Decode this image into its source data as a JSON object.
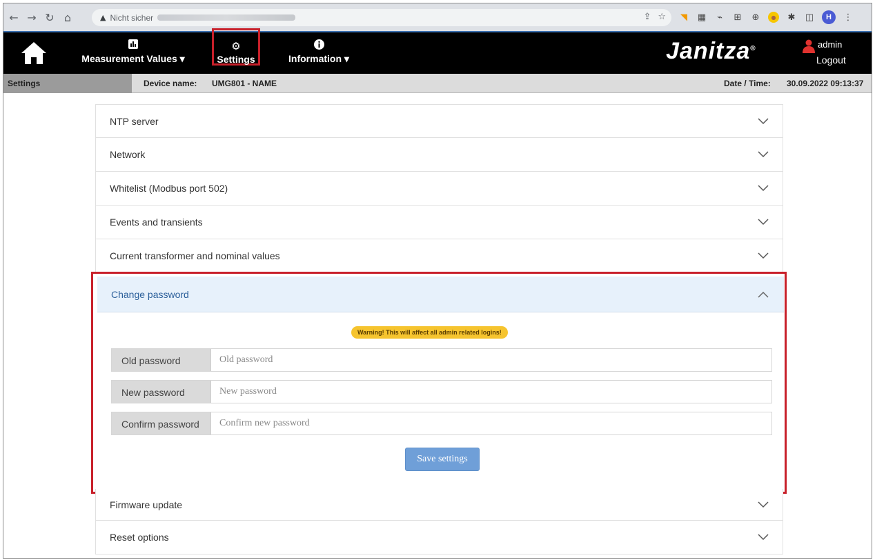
{
  "browser": {
    "security_label": "Nicht sicher",
    "profile_initial": "H"
  },
  "nav": {
    "measurement_label": "Measurement Values ▾",
    "settings_label": "Settings",
    "information_label": "Information ▾",
    "brand": "Janitza",
    "brand_reg": "®",
    "user_name": "admin",
    "logout_label": "Logout"
  },
  "infobar": {
    "section": "Settings",
    "device_name_label": "Device name:",
    "device_name_value": "UMG801 - NAME",
    "datetime_label": "Date / Time:",
    "datetime_value": "30.09.2022 09:13:37"
  },
  "accordion": {
    "items_top": [
      "NTP server",
      "Network",
      "Whitelist (Modbus port 502)",
      "Events and transients",
      "Current transformer and nominal values"
    ],
    "open_item": "Change password",
    "items_bottom": [
      "Firmware update",
      "Reset options"
    ]
  },
  "change_password": {
    "warning": "Warning! This will affect all admin related logins!",
    "old_label": "Old password",
    "old_placeholder": "Old password",
    "new_label": "New password",
    "new_placeholder": "New password",
    "confirm_label": "Confirm password",
    "confirm_placeholder": "Confirm new password",
    "save_label": "Save settings"
  },
  "colors": {
    "highlight": "#c8202a",
    "accent": "#6f9fd8",
    "warning": "#f6c42e"
  }
}
